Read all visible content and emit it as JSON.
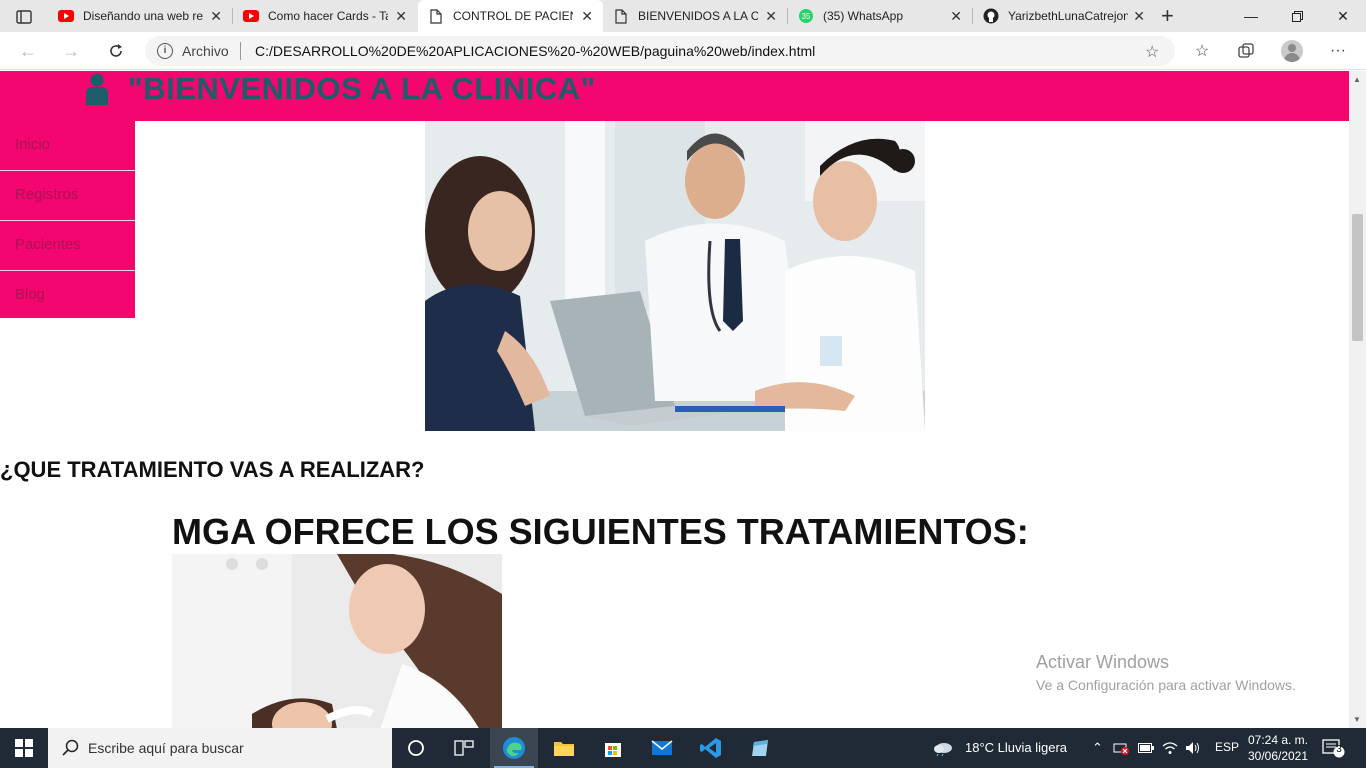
{
  "browser": {
    "tabs": [
      {
        "title": "Diseñando una web re",
        "icon": "youtube-icon",
        "active": false
      },
      {
        "title": "Como hacer Cards - Ta",
        "icon": "youtube-icon",
        "active": false
      },
      {
        "title": "CONTROL DE PACIENT",
        "icon": "document-icon",
        "active": true
      },
      {
        "title": "BIENVENIDOS A LA CL",
        "icon": "document-icon",
        "active": false
      },
      {
        "title": "(35) WhatsApp",
        "icon": "whatsapp-icon",
        "active": false
      },
      {
        "title": "YarizbethLunaCatrejon",
        "icon": "github-icon",
        "active": false
      }
    ],
    "address": {
      "scheme_label": "Archivo",
      "url": "C:/DESARROLLO%20DE%20APLICACIONES%20-%20WEB/paguina%20web/index.html"
    }
  },
  "page": {
    "header_title": "\"BIENVENIDOS A LA CLINICA\"",
    "nav": [
      {
        "label": "Inicio"
      },
      {
        "label": "Registros"
      },
      {
        "label": "Pacientes"
      },
      {
        "label": "Blog"
      }
    ],
    "question": "¿QUE TRATAMIENTO VAS A REALIZAR?",
    "section_title": "MGA OFRECE LOS SIGUIENTES TRATAMIENTOS:",
    "colors": {
      "header_bg": "#f3066e",
      "title_color": "#1d5d6a",
      "nav_text": "#a9125a"
    }
  },
  "watermark": {
    "title": "Activar Windows",
    "subtitle": "Ve a Configuración para activar Windows."
  },
  "taskbar": {
    "search_placeholder": "Escribe aquí para buscar",
    "weather": "18°C  Lluvia ligera",
    "language": "ESP",
    "time": "07:24 a. m.",
    "date": "30/06/2021",
    "notification_count": "3"
  }
}
